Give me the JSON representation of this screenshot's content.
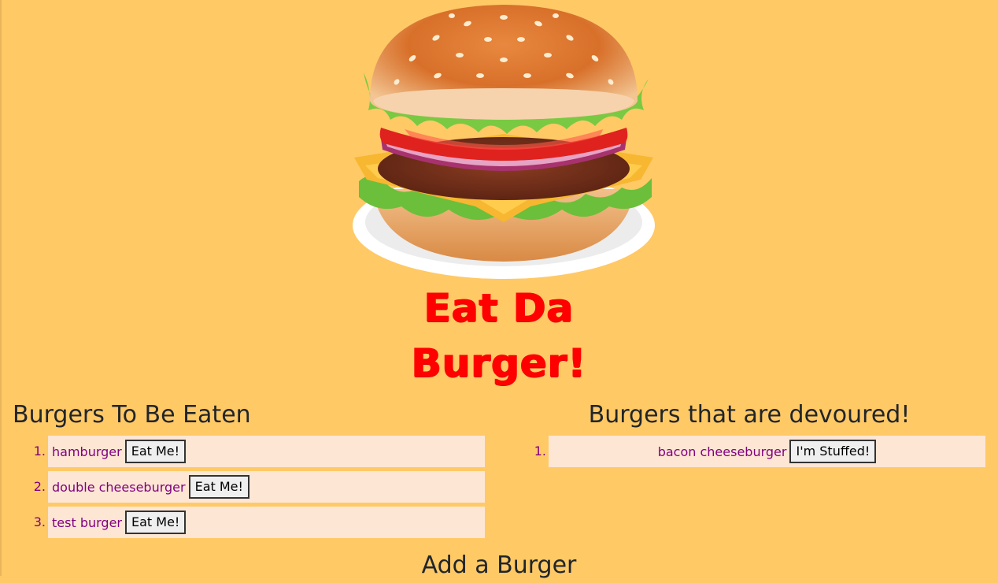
{
  "title_line1": "Eat Da",
  "title_line2": "Burger!",
  "to_eat": {
    "heading": "Burgers To Be Eaten",
    "items": [
      {
        "num": "1.",
        "name": "hamburger",
        "button": "Eat Me!"
      },
      {
        "num": "2.",
        "name": "double cheeseburger",
        "button": "Eat Me!"
      },
      {
        "num": "3.",
        "name": "test burger",
        "button": "Eat Me!"
      }
    ]
  },
  "devoured": {
    "heading": "Burgers that are devoured!",
    "items": [
      {
        "num": "1.",
        "name": "bacon cheeseburger",
        "button": "I'm Stuffed!"
      }
    ]
  },
  "add_heading": "Add a Burger",
  "colors": {
    "background": "#ffc966",
    "title": "#ff0000",
    "item_bg": "#fde6d4",
    "item_text": "#800080"
  },
  "icons": {
    "hero": "burger-image"
  }
}
